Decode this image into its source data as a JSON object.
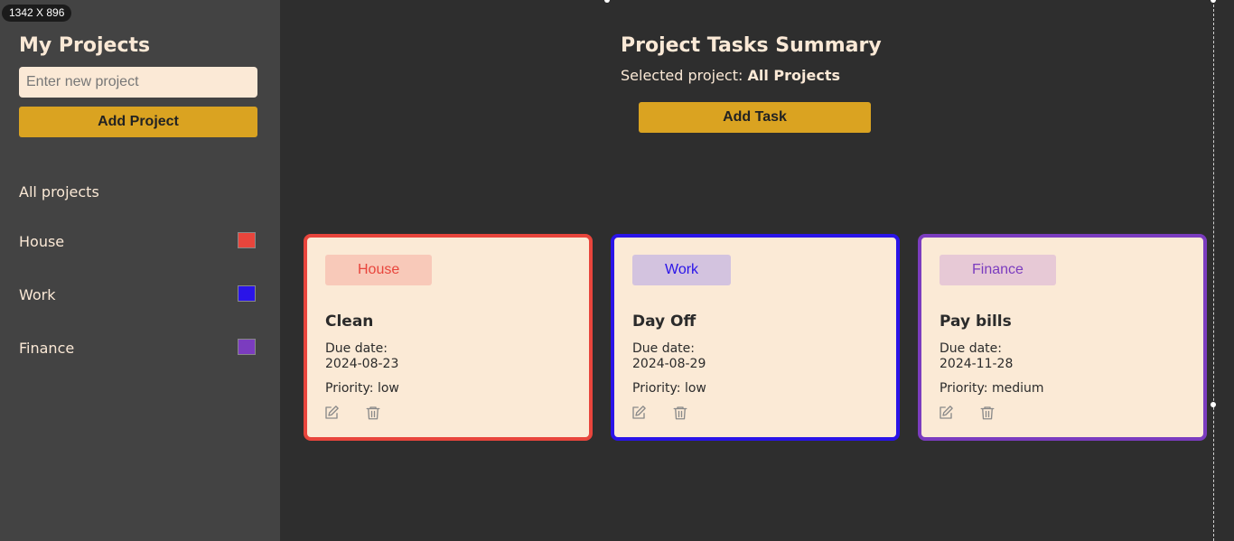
{
  "overlay": {
    "size_badge": "1342 X 896"
  },
  "sidebar": {
    "title": "My Projects",
    "input_placeholder": "Enter new project",
    "add_button": "Add Project",
    "items": [
      {
        "label": "All projects"
      },
      {
        "label": "House",
        "color": "#e8453c"
      },
      {
        "label": "Work",
        "color": "#2a14e8"
      },
      {
        "label": "Finance",
        "color": "#7b3cbf"
      }
    ]
  },
  "main": {
    "title": "Project Tasks Summary",
    "selected_label": "Selected project:",
    "selected_value": "All Projects",
    "add_task_button": "Add Task"
  },
  "tasks": [
    {
      "project": "House",
      "title": "Clean",
      "due_label": "Due date:",
      "due_date": "2024-08-23",
      "priority": "Priority: low",
      "color": "#e8453c",
      "tag_bg": "#f8c9b9",
      "tag_text": "#e8453c"
    },
    {
      "project": "Work",
      "title": "Day Off",
      "due_label": "Due date:",
      "due_date": "2024-08-29",
      "priority": "Priority: low",
      "color": "#2a14e8",
      "tag_bg": "#d3c3df",
      "tag_text": "#2a14e8"
    },
    {
      "project": "Finance",
      "title": "Pay bills",
      "due_label": "Due date:",
      "due_date": "2024-11-28",
      "priority": "Priority: medium",
      "color": "#7b3cbf",
      "tag_bg": "#e7c9d6",
      "tag_text": "#7b3cbf"
    }
  ]
}
